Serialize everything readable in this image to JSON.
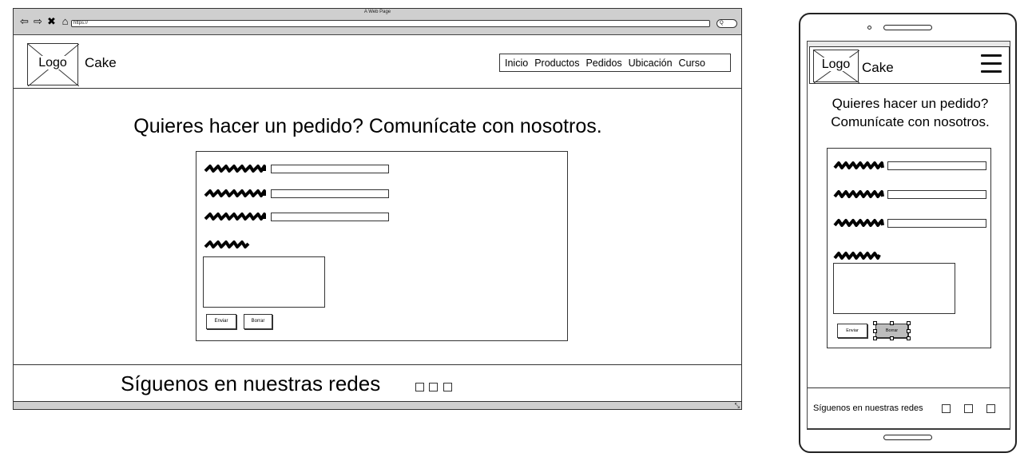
{
  "desktop": {
    "window_title": "A Web Page",
    "nav_buttons": [
      "⇦",
      "⇨",
      "✖",
      "⌂"
    ],
    "address": "https://",
    "search_glyph": "Q",
    "logo": "Logo",
    "brand": "Cake",
    "nav": [
      "Inicio",
      "Productos",
      "Pedidos",
      "Ubicación",
      "Curso"
    ],
    "heading": "Quieres hacer un pedido? Comunícate con nosotros.",
    "form": {
      "send_label": "Enviar",
      "clear_label": "Borrar"
    },
    "footer_text": "Síguenos en nuestras redes",
    "social_icons": [
      "social-icon-1",
      "social-icon-2",
      "social-icon-3"
    ]
  },
  "mobile": {
    "logo": "Logo",
    "brand": "Cake",
    "menu_icon": "hamburger-menu-icon",
    "heading_line1": "Quieres hacer un pedido?",
    "heading_line2": "Comunícate con nosotros.",
    "form": {
      "send_label": "Enviar",
      "clear_label": "Borrar"
    },
    "footer_text": "Síguenos en nuestras redes"
  }
}
